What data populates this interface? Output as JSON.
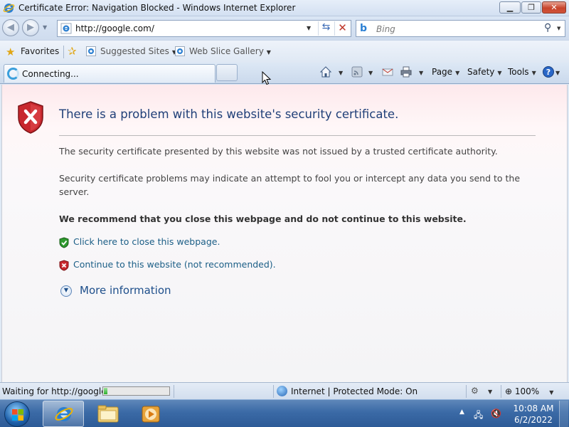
{
  "window": {
    "title": "Certificate Error: Navigation Blocked - Windows Internet Explorer"
  },
  "address_bar": {
    "url": "http://google.com/"
  },
  "search": {
    "placeholder": "Bing"
  },
  "favorites_bar": {
    "favorites_label": "Favorites",
    "items": [
      {
        "label": "Suggested Sites"
      },
      {
        "label": "Web Slice Gallery"
      }
    ]
  },
  "tab": {
    "label": "Connecting..."
  },
  "command_bar": {
    "page_label": "Page",
    "safety_label": "Safety",
    "tools_label": "Tools"
  },
  "content": {
    "title": "There is a problem with this website's security certificate.",
    "paragraph1": "The security certificate presented by this website was not issued by a trusted certificate authority.",
    "paragraph2": "Security certificate problems may indicate an attempt to fool you or intercept any data you send to the server.",
    "recommendation": "We recommend that you close this webpage and do not continue to this website.",
    "close_link": "Click here to close this webpage.",
    "continue_link": "Continue to this website (not recommended).",
    "more_info": "More information"
  },
  "status_bar": {
    "status_text": "Waiting for http://google.",
    "progress": 0.05,
    "zone_text": "Internet | Protected Mode: On",
    "zoom": "100%"
  },
  "taskbar": {
    "time": "10:08 AM",
    "date": "6/2/2022"
  },
  "colors": {
    "error_title": "#1f3f78",
    "link": "#1b5e86",
    "shield_red": "#c8282e",
    "shield_green": "#2f9a2f",
    "taskbar": "#3b6aa6"
  }
}
